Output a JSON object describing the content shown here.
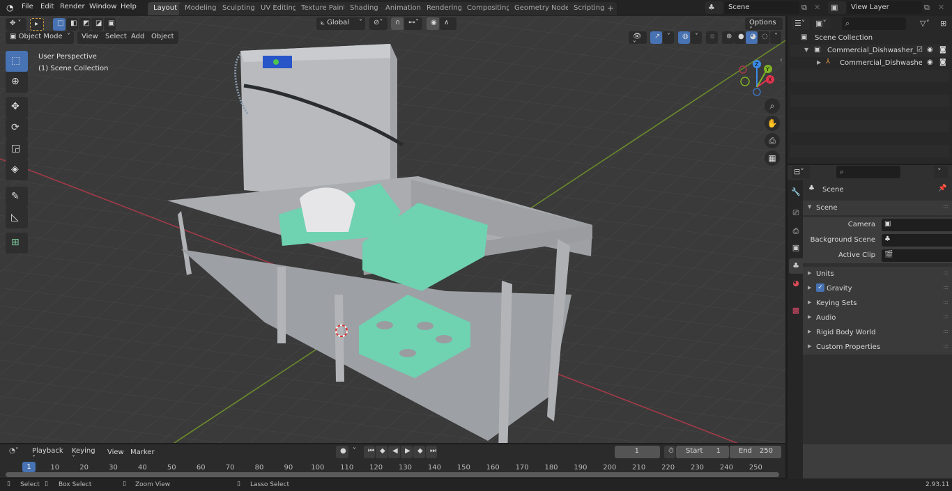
{
  "app": {
    "version": "2.93.11"
  },
  "topbar": {
    "menus": [
      "File",
      "Edit",
      "Render",
      "Window",
      "Help"
    ],
    "workspace_tabs": [
      "Layout",
      "Modeling",
      "Sculpting",
      "UV Editing",
      "Texture Paint",
      "Shading",
      "Animation",
      "Rendering",
      "Compositing",
      "Geometry Nodes",
      "Scripting"
    ],
    "active_tab": "Layout",
    "add_tab_label": "+",
    "scene_name": "Scene",
    "view_layer": "View Layer"
  },
  "viewport_header": {
    "mode": "Object Mode",
    "menus": [
      "View",
      "Select",
      "Add",
      "Object"
    ],
    "transform_orientation": "Global",
    "options_label": "Options"
  },
  "viewport": {
    "overlay_line1": "User Perspective",
    "overlay_line2": "(1) Scene Collection",
    "axis_labels": {
      "x": "X",
      "y": "Y",
      "z": "Z"
    },
    "axis_colors": {
      "x": "#e2344e",
      "y": "#7fb224",
      "z": "#3c8ce7"
    },
    "object_colors": {
      "body": "#a6a8ac",
      "crate": "#6fd2b0",
      "panel": "#2855c8"
    }
  },
  "outliner": {
    "root": "Scene Collection",
    "items": [
      {
        "label": "Commercial_Dishwasher_with",
        "level": 1,
        "type": "collection"
      },
      {
        "label": "Commercial_Dishwasher_",
        "level": 2,
        "type": "object"
      }
    ]
  },
  "properties": {
    "context_title": "Scene",
    "panel_title": "Scene",
    "fields": [
      {
        "label": "Camera",
        "value": ""
      },
      {
        "label": "Background Scene",
        "value": ""
      },
      {
        "label": "Active Clip",
        "value": ""
      }
    ],
    "sections": [
      "Units",
      "Gravity",
      "Keying Sets",
      "Audio",
      "Rigid Body World",
      "Custom Properties"
    ],
    "gravity_checked": true
  },
  "timeline": {
    "menus": [
      "Playback",
      "Keying",
      "View",
      "Marker"
    ],
    "current_frame": "1",
    "start_label": "Start",
    "start": "1",
    "end_label": "End",
    "end": "250",
    "ticks": [
      "10",
      "20",
      "30",
      "40",
      "50",
      "60",
      "70",
      "80",
      "90",
      "100",
      "110",
      "120",
      "130",
      "140",
      "150",
      "160",
      "170",
      "180",
      "190",
      "200",
      "210",
      "220",
      "230",
      "240",
      "250"
    ],
    "playhead": "1"
  },
  "statusbar": {
    "items": [
      "Select",
      "Box Select",
      "Zoom View",
      "Lasso Select"
    ]
  }
}
